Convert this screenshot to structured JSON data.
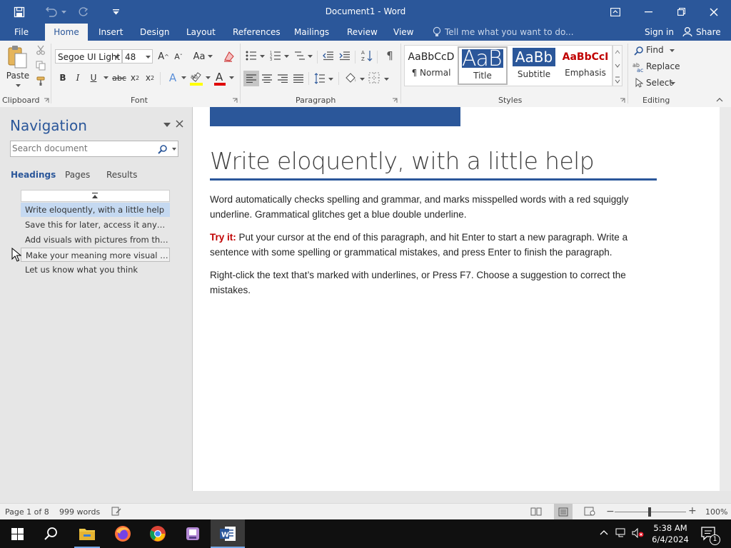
{
  "window": {
    "title": "Document1 - Word"
  },
  "tabs": [
    "File",
    "Home",
    "Insert",
    "Design",
    "Layout",
    "References",
    "Mailings",
    "Review",
    "View"
  ],
  "tell_me": "Tell me what you want to do...",
  "account": {
    "sign_in": "Sign in",
    "share": "Share"
  },
  "ribbon": {
    "clipboard": {
      "paste": "Paste",
      "label": "Clipboard"
    },
    "font": {
      "name": "Segoe UI Light",
      "size": "48",
      "label": "Font",
      "case": "Aa"
    },
    "paragraph": {
      "label": "Paragraph"
    },
    "styles": {
      "label": "Styles",
      "items": [
        {
          "preview": "AaBbCcD",
          "name": "¶ Normal"
        },
        {
          "preview": "AaBb",
          "name": "Title"
        },
        {
          "preview": "AaBb",
          "name": "Subtitle"
        },
        {
          "preview": "AaBbCcI",
          "name": "Emphasis"
        }
      ]
    },
    "editing": {
      "find": "Find",
      "replace": "Replace",
      "select": "Select",
      "label": "Editing"
    }
  },
  "navigation": {
    "title": "Navigation",
    "search_placeholder": "Search document",
    "tabs": [
      "Headings",
      "Pages",
      "Results"
    ],
    "headings": [
      "Write eloquently, with a little help",
      "Save this for later, access it anywhere",
      "Add visuals with pictures from the web",
      "Make your meaning more visual by formatting text",
      "Let us know what you think"
    ]
  },
  "document": {
    "heading": "Write eloquently, with a little help",
    "p1": "Word automatically checks spelling and grammar, and marks misspelled words with a red squiggly underline. Grammatical glitches get a blue double underline.",
    "p2_label": "Try it:",
    "p2": " Put your cursor at the end of this paragraph, and hit Enter to start a new paragraph. Write a sentence with some spelling or grammatical mistakes, and press Enter to finish the paragraph.",
    "p3": "Right-click the text that’s marked with underlines, or Press F7. Choose a suggestion to correct the mistakes."
  },
  "status": {
    "page": "Page 1 of 8",
    "words": "999 words",
    "zoom": "100%"
  },
  "taskbar": {
    "time": "5:38 AM",
    "date": "6/4/2024",
    "notifications": "1"
  },
  "colors": {
    "brand": "#2b579a",
    "try_it": "#c00000",
    "accent_bar": "#2b579a"
  }
}
